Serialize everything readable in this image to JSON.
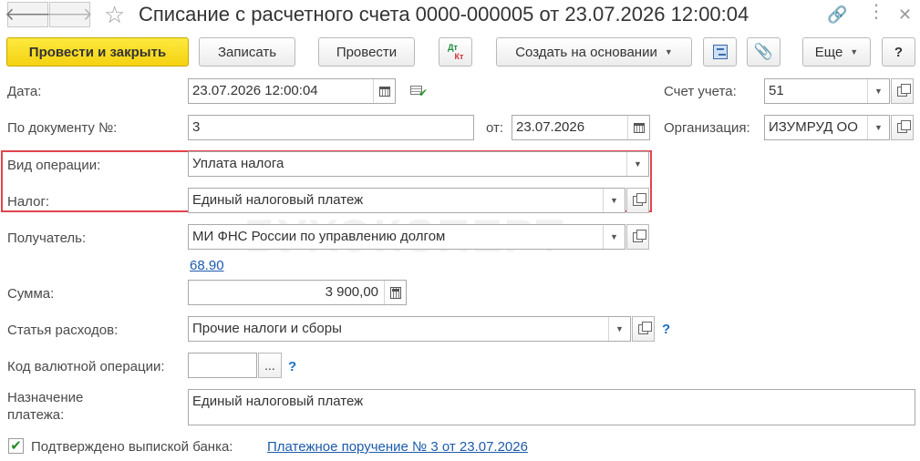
{
  "window": {
    "title": "Списание с расчетного счета 0000-000005 от 23.07.2026 12:00:04"
  },
  "toolbar": {
    "post_close": "Провести и закрыть",
    "save": "Записать",
    "post": "Провести",
    "dtkt_top": "Дт",
    "dtkt_bottom": "Кт",
    "create_based": "Создать на основании",
    "more": "Еще",
    "help": "?"
  },
  "form": {
    "date_label": "Дата:",
    "date_value": "23.07.2026 12:00:04",
    "account_label": "Счет учета:",
    "account_value": "51",
    "docnum_label": "По документу №:",
    "docnum_value": "3",
    "from_label": "от:",
    "from_value": "23.07.2026",
    "org_label": "Организация:",
    "org_value": "ИЗУМРУД ОО",
    "optype_label": "Вид операции:",
    "optype_value": "Уплата налога",
    "tax_label": "Налог:",
    "tax_value": "Единый налоговый платеж",
    "recipient_label": "Получатель:",
    "recipient_value": "МИ ФНС России по управлению долгом",
    "recipient_account_link": "68.90",
    "amount_label": "Сумма:",
    "amount_value": "3 900,00",
    "expense_label": "Статья расходов:",
    "expense_value": "Прочие налоги и сборы",
    "currency_label": "Код валютной операции:",
    "currency_value": "",
    "currency_btn": "...",
    "purpose_label_1": "Назначение",
    "purpose_label_2": "платежа:",
    "purpose_value": "Единый налоговый платеж",
    "confirmed_label": "Подтверждено выпиской банка:",
    "confirmed_checked": true,
    "payment_order_link": "Платежное поручение № 3 от 23.07.2026",
    "help_mark": "?"
  },
  "watermark": "БУХЭКСПЕРТ",
  "colors": {
    "primary_button": "#f5d211",
    "highlight_border": "#e0454d",
    "link": "#1c5bab"
  }
}
